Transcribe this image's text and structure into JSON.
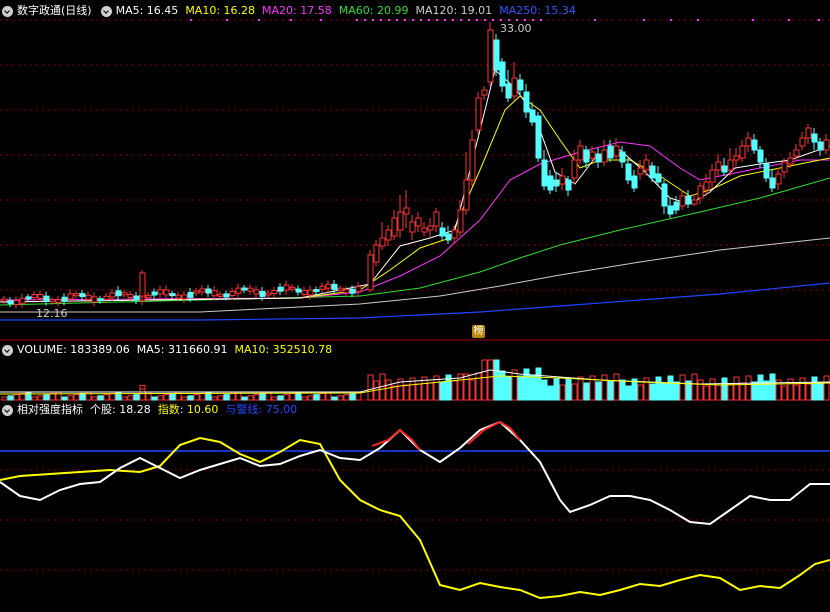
{
  "header": {
    "title": "数字政通(日线)",
    "ma": [
      {
        "label": "MA5: 16.45",
        "color": "#ffffff"
      },
      {
        "label": "MA10: 16.28",
        "color": "#ffff00"
      },
      {
        "label": "MA20: 17.58",
        "color": "#ff33ff"
      },
      {
        "label": "MA60: 20.99",
        "color": "#33dd33"
      },
      {
        "label": "MA120: 19.01",
        "color": "#cccccc"
      },
      {
        "label": "MA250: 15.34",
        "color": "#3355ff"
      }
    ]
  },
  "price_labels": {
    "high": "33.00",
    "low": "12.16"
  },
  "badge_label": "榜",
  "volume_header": [
    {
      "label": "VOLUME: 183389.06",
      "color": "#ffffff"
    },
    {
      "label": "MA5: 311660.91",
      "color": "#ffffff"
    },
    {
      "label": "MA10: 352510.78",
      "color": "#ffff00"
    }
  ],
  "indicator_header": {
    "name": "相对强度指标",
    "items": [
      {
        "label": "个股: 18.28",
        "color": "#ffffff"
      },
      {
        "label": "指数: 10.60",
        "color": "#ffff00"
      },
      {
        "label": "与警线: 75.00",
        "color": "#2244ff"
      }
    ]
  },
  "colors": {
    "up": "#ff3333",
    "down": "#54ffff",
    "grid": "#8b0000"
  }
}
